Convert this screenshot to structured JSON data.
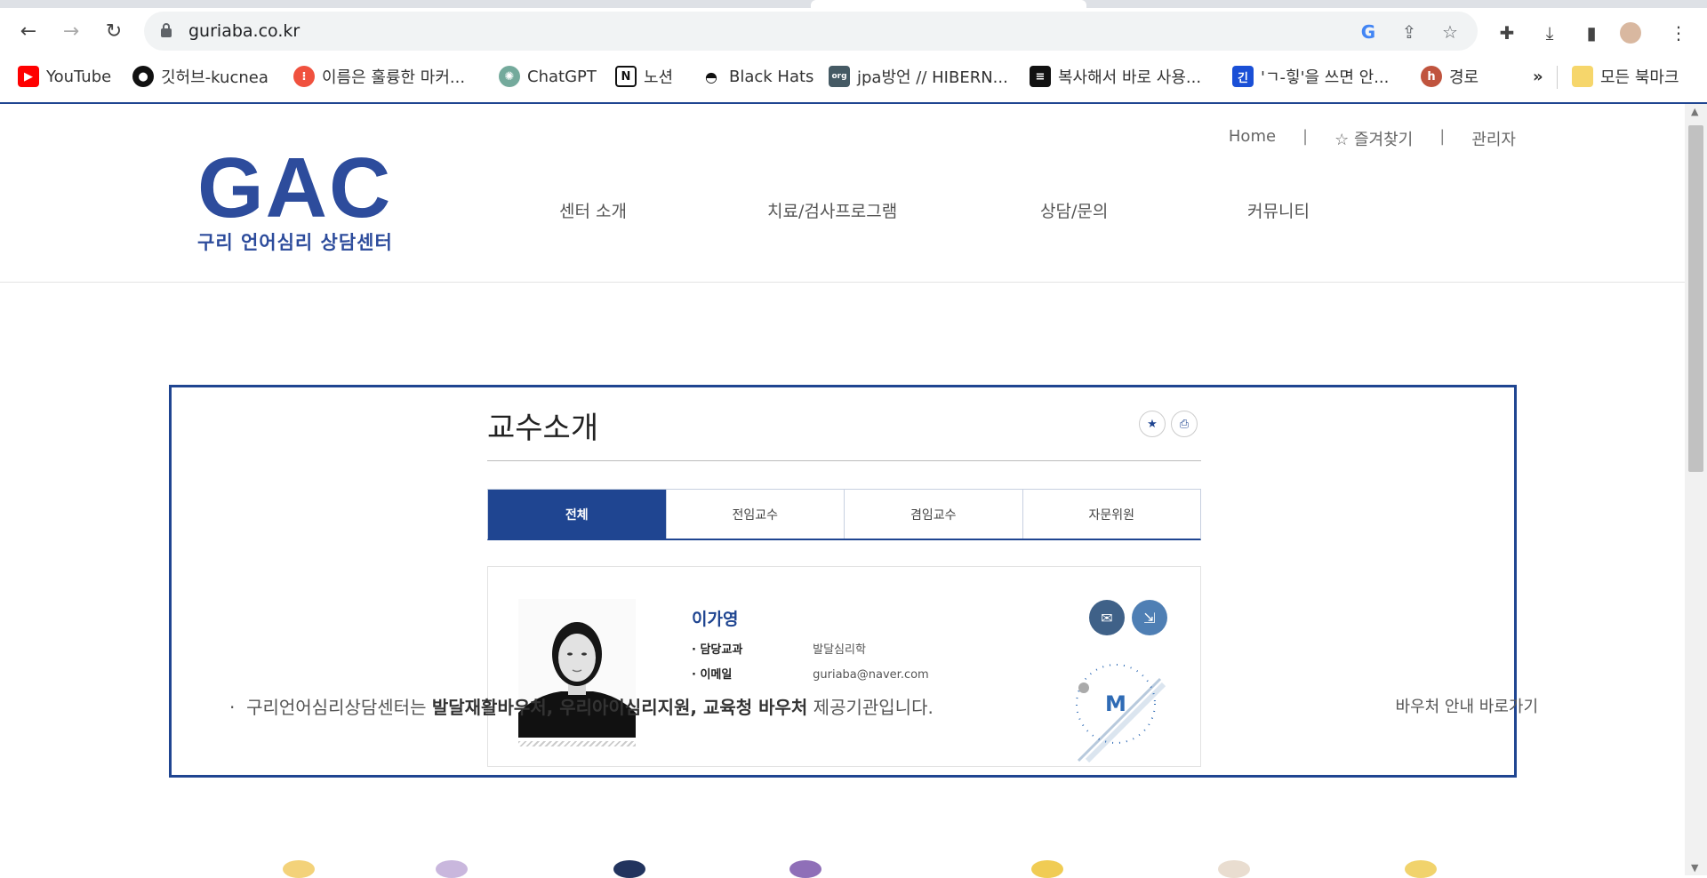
{
  "browser": {
    "url": "guriaba.co.kr",
    "bookmarks": [
      {
        "label": "YouTube",
        "icon": "youtube-icon",
        "color": "#ff0000"
      },
      {
        "label": "깃허브-kucnea",
        "icon": "github-icon",
        "color": "#111111"
      },
      {
        "label": "이름은 훌륭한 마커...",
        "icon": "marker-icon",
        "color": "#f0513e"
      },
      {
        "label": "ChatGPT",
        "icon": "chatgpt-icon",
        "color": "#74aa9c"
      },
      {
        "label": "노션",
        "icon": "notion-icon",
        "color": "#111111"
      },
      {
        "label": "Black Hats",
        "icon": "hat-icon",
        "color": "#111111"
      },
      {
        "label": "jpa방언 // HIBERN...",
        "icon": "jboss-icon",
        "color": "#455a64"
      },
      {
        "label": "복사해서 바로 사용...",
        "icon": "note-icon",
        "color": "#111111"
      },
      {
        "label": "'ㄱ-힣'을 쓰면 안...",
        "icon": "hangul-icon",
        "color": "#1a4fd6"
      },
      {
        "label": "경로",
        "icon": "h-icon",
        "color": "#c0543e"
      }
    ],
    "overflow_label": "»",
    "all_bookmarks": "모든 북마크"
  },
  "site": {
    "util_nav": [
      "Home",
      "☆ 즐겨찾기",
      "관리자"
    ],
    "logo_main": "GAC",
    "logo_sub": "구리 언어심리 상담센터",
    "main_nav": [
      "센터 소개",
      "치료/검사프로그램",
      "상담/문의",
      "커뮤니티"
    ],
    "page_title": "교수소개",
    "tabs": [
      "전체",
      "전임교수",
      "겸임교수",
      "자문위원"
    ],
    "active_tab": 0,
    "professor": {
      "name": "이가영",
      "subject_label": "· 담당교과",
      "subject_value": "발달심리학",
      "email_label": "· 이메일",
      "email_value": "guriaba@naver.com"
    },
    "notice_prefix": "구리언어심리상담센터는 ",
    "notice_bold": "발달재활바우처, 우리아이심리지원, 교육청 바우처",
    "notice_suffix": " 제공기관입니다.",
    "notice_link": "바우처 안내 바로가기"
  },
  "colors": {
    "brand": "#1f4591",
    "logo": "#2d4c9c"
  }
}
